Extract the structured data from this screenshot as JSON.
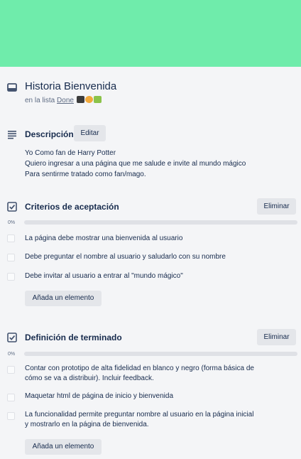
{
  "card": {
    "title": "Historia Bienvenida",
    "list_prefix": "en la lista",
    "list_name": "Done",
    "cover_color": "#6fecab",
    "header_icon": "card-icon"
  },
  "description": {
    "heading": "Descripción",
    "edit_label": "Editar",
    "icon": "description-icon",
    "lines": [
      "Yo Como fan de Harry Potter",
      "Quiero ingresar a una página que me salude e invite al mundo mágico",
      "Para sentirme tratado como fan/mago."
    ]
  },
  "checklists": [
    {
      "title": "Criterios de aceptación",
      "delete_label": "Eliminar",
      "percent": "0%",
      "progress": 0,
      "items": [
        "La página debe mostrar una bienvenida al usuario",
        "Debe preguntar el nombre al usuario y saludarlo con su nombre",
        "Debe invitar al usuario a entrar al \"mundo mágico\""
      ],
      "add_label": "Añada un elemento"
    },
    {
      "title": "Definición de terminado",
      "delete_label": "Eliminar",
      "percent": "0%",
      "progress": 0,
      "items": [
        "Contar con prototipo de alta fidelidad en blanco y negro (forma básica de cómo se va a distribuir). Incluir feedback.",
        "Maquetar html de página de inicio y bienvenida",
        "La funcionalidad permite preguntar nombre al usuario en la página inicial y mostrarlo en la página de bienvenida."
      ],
      "add_label": "Añada un elemento"
    }
  ]
}
